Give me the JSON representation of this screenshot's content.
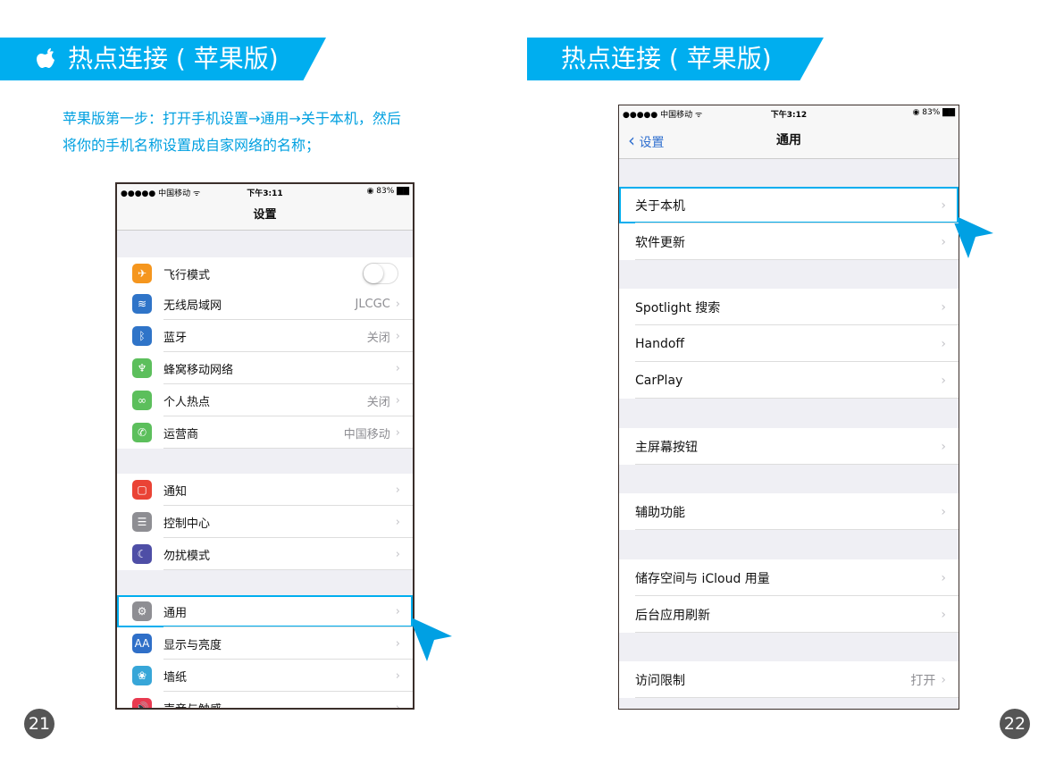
{
  "left_page": {
    "title": "热点连接 ( 苹果版)",
    "intro_line1": "苹果版第一步：打开手机设置→通用→关于本机，然后",
    "intro_line2": "将你的手机名称设置成自家网络的名称；",
    "page_number": "21",
    "phone": {
      "carrier": "●●●●● 中国移动 ᯤ",
      "time": "下午3:11",
      "battery": "◉ 83% ▇▇",
      "nav_title": "设置",
      "rows": [
        {
          "label": "飞行模式",
          "icon": "airplane-icon",
          "color": "#f5961e",
          "glyph": "✈",
          "toggle": false
        },
        {
          "label": "无线局域网",
          "icon": "wifi-icon",
          "color": "#2f74c8",
          "glyph": "≋",
          "value": "JLCGC"
        },
        {
          "label": "蓝牙",
          "icon": "bluetooth-icon",
          "color": "#2f74c8",
          "glyph": "ᛒ",
          "value": "关闭"
        },
        {
          "label": "蜂窝移动网络",
          "icon": "cellular-icon",
          "color": "#5cbf5c",
          "glyph": "♆"
        },
        {
          "label": "个人热点",
          "icon": "hotspot-icon",
          "color": "#5cbf5c",
          "glyph": "∞",
          "value": "关闭"
        },
        {
          "label": "运营商",
          "icon": "phone-icon",
          "color": "#5cbf5c",
          "glyph": "✆",
          "value": "中国移动"
        },
        {
          "label": "通知",
          "icon": "notification-icon",
          "color": "#ea4335",
          "glyph": "▢"
        },
        {
          "label": "控制中心",
          "icon": "control-center-icon",
          "color": "#8e8e93",
          "glyph": "☰"
        },
        {
          "label": "勿扰模式",
          "icon": "moon-icon",
          "color": "#4e4ea6",
          "glyph": "☾"
        },
        {
          "label": "通用",
          "icon": "gear-icon",
          "color": "#8e8e93",
          "glyph": "⚙",
          "highlight": true
        },
        {
          "label": "显示与亮度",
          "icon": "display-icon",
          "color": "#2f6fc8",
          "glyph": "AA"
        },
        {
          "label": "墙纸",
          "icon": "wallpaper-icon",
          "color": "#37a6d8",
          "glyph": "❀"
        },
        {
          "label": "声音与触感",
          "icon": "sound-icon",
          "color": "#e83a50",
          "glyph": "🔊"
        }
      ]
    }
  },
  "right_page": {
    "title": "热点连接 ( 苹果版)",
    "page_number": "22",
    "phone": {
      "carrier": "●●●●● 中国移动 ᯤ",
      "time": "下午3:12",
      "battery": "◉ 83% ▇▇",
      "back_label": "设置",
      "nav_title": "通用",
      "rows": [
        {
          "label": "关于本机",
          "highlight": true
        },
        {
          "label": "软件更新"
        },
        {
          "label": "Spotlight 搜索"
        },
        {
          "label": "Handoff"
        },
        {
          "label": "CarPlay"
        },
        {
          "label": "主屏幕按钮"
        },
        {
          "label": "辅助功能"
        },
        {
          "label": "储存空间与 iCloud 用量"
        },
        {
          "label": "后台应用刷新"
        },
        {
          "label": "访问限制",
          "value": "打开"
        }
      ]
    }
  },
  "colors": {
    "accent": "#00aeef",
    "page_badge": "#555555"
  }
}
